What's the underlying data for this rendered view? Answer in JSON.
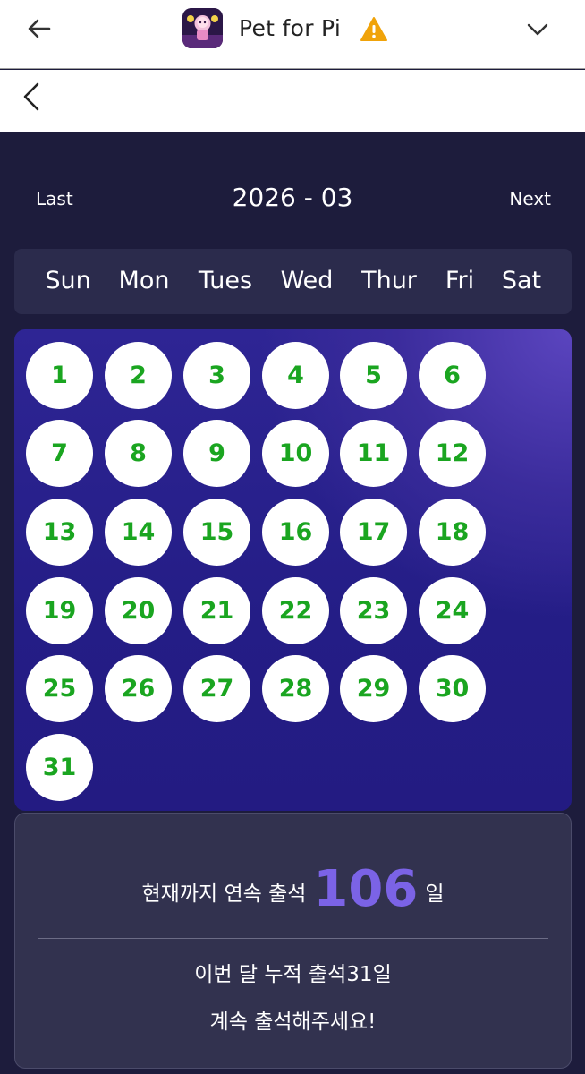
{
  "app": {
    "title": "Pet for Pi",
    "icons": {
      "back": "arrow-left-icon",
      "warning": "warning-icon",
      "menu": "chevron-down-icon",
      "nav_back": "chevron-left-icon"
    },
    "colors": {
      "warning": "#f0a30a"
    }
  },
  "calendar": {
    "month_label": "2026 - 03",
    "last_label": "Last",
    "next_label": "Next",
    "weekdays": [
      "Sun",
      "Mon",
      "Tues",
      "Wed",
      "Thur",
      "Fri",
      "Sat"
    ],
    "days": [
      "1",
      "2",
      "3",
      "4",
      "5",
      "6",
      "7",
      "8",
      "9",
      "10",
      "11",
      "12",
      "13",
      "14",
      "15",
      "16",
      "17",
      "18",
      "19",
      "20",
      "21",
      "22",
      "23",
      "24",
      "25",
      "26",
      "27",
      "28",
      "29",
      "30",
      "31"
    ],
    "colors": {
      "day_text": "#1aa520",
      "day_bg": "#ffffff",
      "panel": "#2e2594"
    }
  },
  "stats": {
    "streak_prefix": "현재까지 연속 출석",
    "streak_value": "106",
    "streak_suffix": "일",
    "monthly_text": "이번 달 누적 출석31일",
    "encourage_text": "계속 출석해주세요!",
    "colors": {
      "streak_value": "#7b63e6"
    }
  }
}
